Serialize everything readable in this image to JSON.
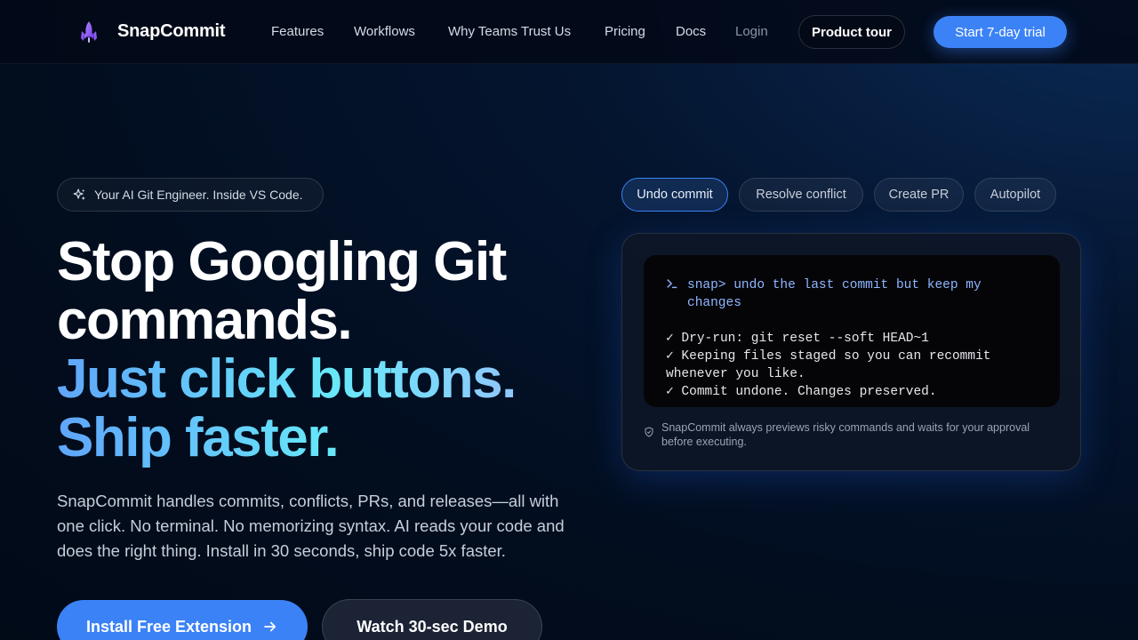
{
  "brand": {
    "name": "SnapCommit",
    "accent": "#3b82f6",
    "logo_icon": "rocket-icon"
  },
  "nav": {
    "links": [
      "Features",
      "Workflows",
      "Why Teams Trust Us",
      "Pricing",
      "Docs"
    ],
    "login": "Login",
    "tour_button": "Product tour",
    "trial_button": "Start 7-day trial"
  },
  "hero": {
    "badge": "Your AI Git Engineer. Inside VS Code.",
    "badge_icon": "sparkles-icon",
    "headline": {
      "line1": "Stop Googling Git",
      "line2": "commands.",
      "line3": "Just click buttons.",
      "line4": "Ship faster."
    },
    "subtitle": "SnapCommit handles commits, conflicts, PRs, and releases—all with one click. No terminal. No memorizing syntax. AI reads your code and does the right thing. Install in 30 seconds, ship code 5x faster.",
    "install_button": "Install Free Extension",
    "demo_button": "Watch 30-sec Demo"
  },
  "demo": {
    "tabs": [
      "Undo commit",
      "Resolve conflict",
      "Create PR",
      "Autopilot"
    ],
    "active_tab": "Undo commit",
    "terminal": {
      "prompt": "snap>",
      "command": "undo the last commit but keep my changes",
      "lines": [
        "✓ Dry-run: git reset --soft HEAD~1",
        "✓ Keeping files staged so you can recommit whenever you like.",
        "✓ Commit undone. Changes preserved."
      ]
    },
    "safety_note": "SnapCommit always previews risky commands and waits for your approval before executing."
  }
}
